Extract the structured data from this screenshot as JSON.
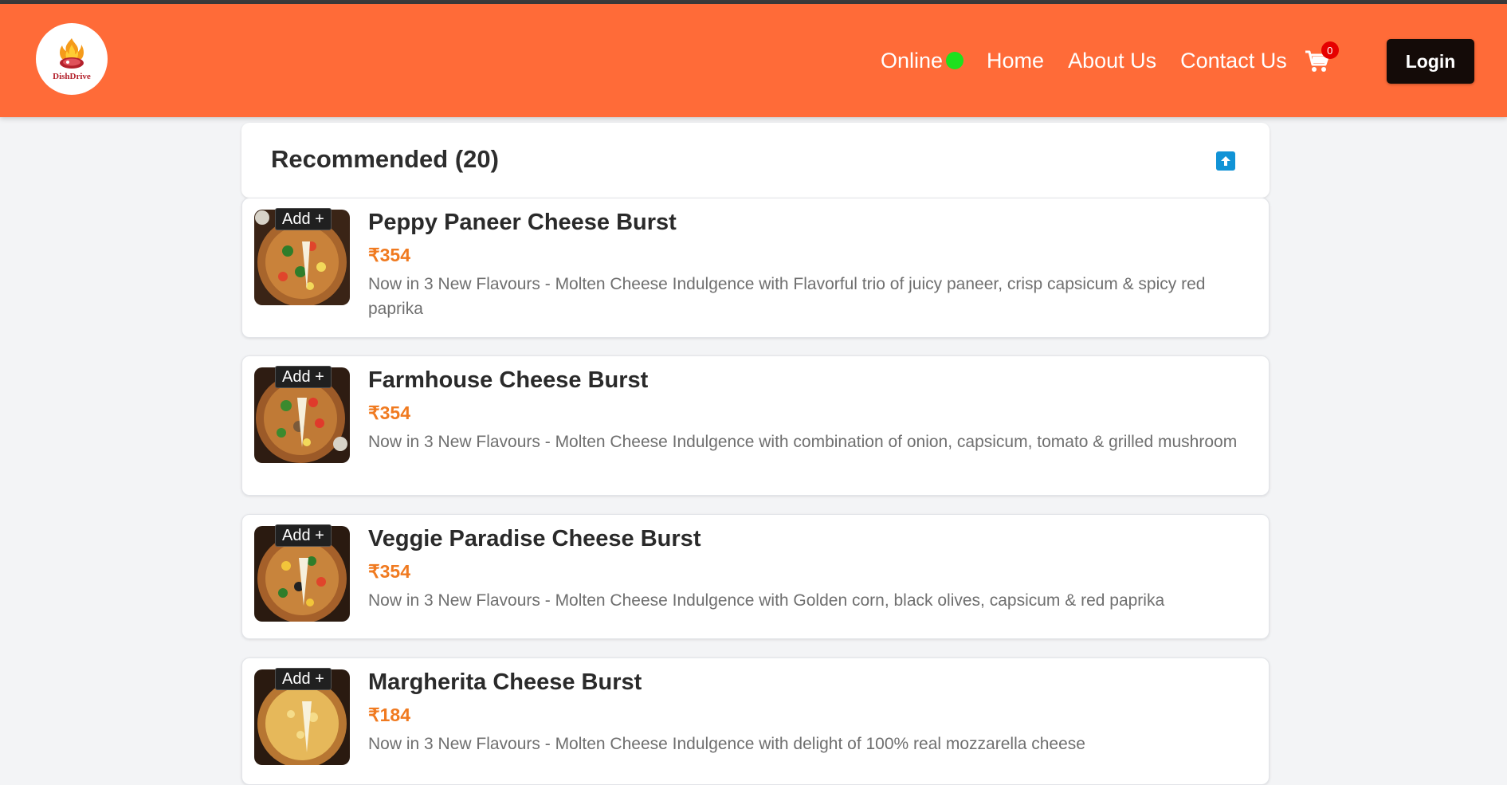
{
  "brand": {
    "logo_text": "DishDrive",
    "logo_icon": "flame-steak-icon"
  },
  "nav": {
    "online_label": "Online",
    "home_label": "Home",
    "about_label": "About Us",
    "contact_label": "Contact Us",
    "cart_count": "0",
    "login_label": "Login"
  },
  "section": {
    "title": "Recommended (20)",
    "scroll_top_icon": "arrow-up-icon"
  },
  "items": [
    {
      "name": "Peppy Paneer Cheese Burst",
      "price": "₹354",
      "description": "Now in 3 New Flavours - Molten Cheese Indulgence with Flavorful trio of juicy paneer, crisp capsicum & spicy red paprika",
      "add_label": "Add +"
    },
    {
      "name": "Farmhouse Cheese Burst",
      "price": "₹354",
      "description": "Now in 3 New Flavours - Molten Cheese Indulgence with combination of onion, capsicum, tomato & grilled mushroom",
      "add_label": "Add +"
    },
    {
      "name": "Veggie Paradise Cheese Burst",
      "price": "₹354",
      "description": "Now in 3 New Flavours - Molten Cheese Indulgence with Golden corn, black olives, capsicum & red paprika",
      "add_label": "Add +"
    },
    {
      "name": "Margherita Cheese Burst",
      "price": "₹184",
      "description": "Now in 3 New Flavours - Molten Cheese Indulgence with delight of 100% real mozzarella cheese",
      "add_label": "Add +"
    }
  ],
  "colors": {
    "header": "#ff6b38",
    "price": "#f07a20",
    "online_dot": "#1ee01e",
    "login_bg": "#140b08",
    "cart_badge": "#e60000",
    "scroll_top": "#1193d6"
  }
}
